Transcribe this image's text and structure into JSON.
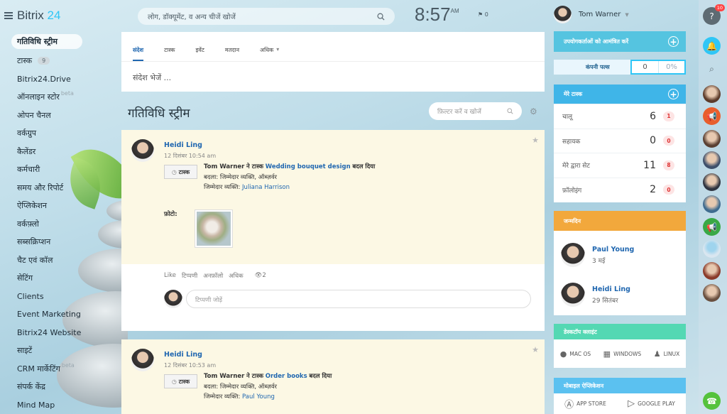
{
  "app": {
    "logo_main": "Bitrix",
    "logo_num": "24"
  },
  "sidebar": {
    "items": [
      {
        "label": "गतिविधि स्ट्रीम",
        "active": true
      },
      {
        "label": "टास्क",
        "counter": "9"
      },
      {
        "label": "Bitrix24.Drive"
      },
      {
        "label": "ऑनलाइन स्टोर",
        "beta": "beta"
      },
      {
        "label": "ओपन चैनल"
      },
      {
        "label": "वर्कग्रुप"
      },
      {
        "label": "कैलेंडर"
      },
      {
        "label": "कर्मचारी"
      },
      {
        "label": "समय और रिपोर्ट"
      },
      {
        "label": "ऐप्लिकेशन"
      },
      {
        "label": "वर्कफ़्लो"
      },
      {
        "label": "सब्सक्रिप्शन"
      },
      {
        "label": "चैट एवं कॉल"
      },
      {
        "label": "सेटिंग"
      },
      {
        "label": "Clients"
      },
      {
        "label": "Event Marketing"
      },
      {
        "label": "Bitrix24 Website"
      },
      {
        "label": "साइटें"
      },
      {
        "label": "CRM मार्केटिंग",
        "beta": "beta"
      },
      {
        "label": "संपर्क केंद्र"
      },
      {
        "label": "Mind Map"
      }
    ]
  },
  "header": {
    "search_placeholder": "लोग, डॉक्यूमेंट, व अन्य चीजें खोजें",
    "time": "8:57",
    "ampm": "AM",
    "flag_count": "0",
    "user_name": "Tom Warner"
  },
  "composer": {
    "tabs": [
      "संदेश",
      "टास्क",
      "इवेंट",
      "मतदान",
      "अधिक"
    ],
    "placeholder": "संदेश भेजें ..."
  },
  "stream": {
    "title": "गतिविधि स्ट्रीम",
    "filter_placeholder": "फ़िल्टर करें व खोजें"
  },
  "posts": [
    {
      "author": "Heidi Ling",
      "date": "12 दिसंबर 10:54 am",
      "badge": "टास्क",
      "actor": "Tom Warner",
      "verb": "ने टास्क",
      "task": "Wedding bouquet design",
      "changed": "बदल दिया",
      "changed_label": "बदला:",
      "changed_value": "जिम्मेदार व्यक्ति, ऑब्ज़र्वर",
      "resp_label": "जिम्मेदार व्यक्ति:",
      "resp_name": "Juliana Harrison",
      "photo_label": "फ़ोटो:",
      "actions": [
        "Like",
        "टिप्पणी",
        "अनफ़ॉलो",
        "अधिक"
      ],
      "views": "2",
      "comment_placeholder": "टिप्पणी जोड़ें"
    },
    {
      "author": "Heidi Ling",
      "date": "12 दिसंबर 10:53 am",
      "badge": "टास्क",
      "actor": "Tom Warner",
      "verb": "ने टास्क",
      "task": "Order books",
      "changed": "बदल दिया",
      "changed_label": "बदला:",
      "changed_value": "जिम्मेदार व्यक्ति, ऑब्ज़र्वर",
      "resp_label": "जिम्मेदार व्यक्ति:",
      "resp_name": "Paul Young"
    }
  ],
  "right": {
    "invite": "उपयोगकर्ताओं को आमंत्रित करें",
    "pulse_label": "कंपनी पल्स",
    "pulse_value": "0",
    "pulse_percent": "0%",
    "my_tasks_title": "मेरे टास्क",
    "tasks": [
      {
        "label": "चालू",
        "value": "6",
        "count": "1"
      },
      {
        "label": "सहायक",
        "value": "0",
        "count": "0"
      },
      {
        "label": "मेरे द्वारा सेट",
        "value": "11",
        "count": "8"
      },
      {
        "label": "फ़ॉलोइंग",
        "value": "2",
        "count": "0"
      }
    ],
    "birthdays_title": "जन्मदिन",
    "birthdays": [
      {
        "name": "Paul Young",
        "date": "3 मई"
      },
      {
        "name": "Heidi Ling",
        "date": "29 सितंबर"
      }
    ],
    "desktop_title": "डेस्कटॉप क्लाइंट",
    "desktop_apps": [
      "MAC OS",
      "WINDOWS",
      "LINUX"
    ],
    "mobile_title": "मोबाइल ऐप्लिकेशन",
    "mobile_apps": [
      "APP STORE",
      "GOOGLE PLAY"
    ]
  },
  "rail": {
    "help_badge": "10"
  },
  "colors": {
    "accent": "#2fc6f6",
    "link": "#2067b0",
    "invite_header": "#55c4e0",
    "tasks_header": "#3fb5e8",
    "birthday_header": "#f2a83c",
    "desktop_header": "#54d8b3",
    "mobile_header": "#5bc1f0"
  }
}
